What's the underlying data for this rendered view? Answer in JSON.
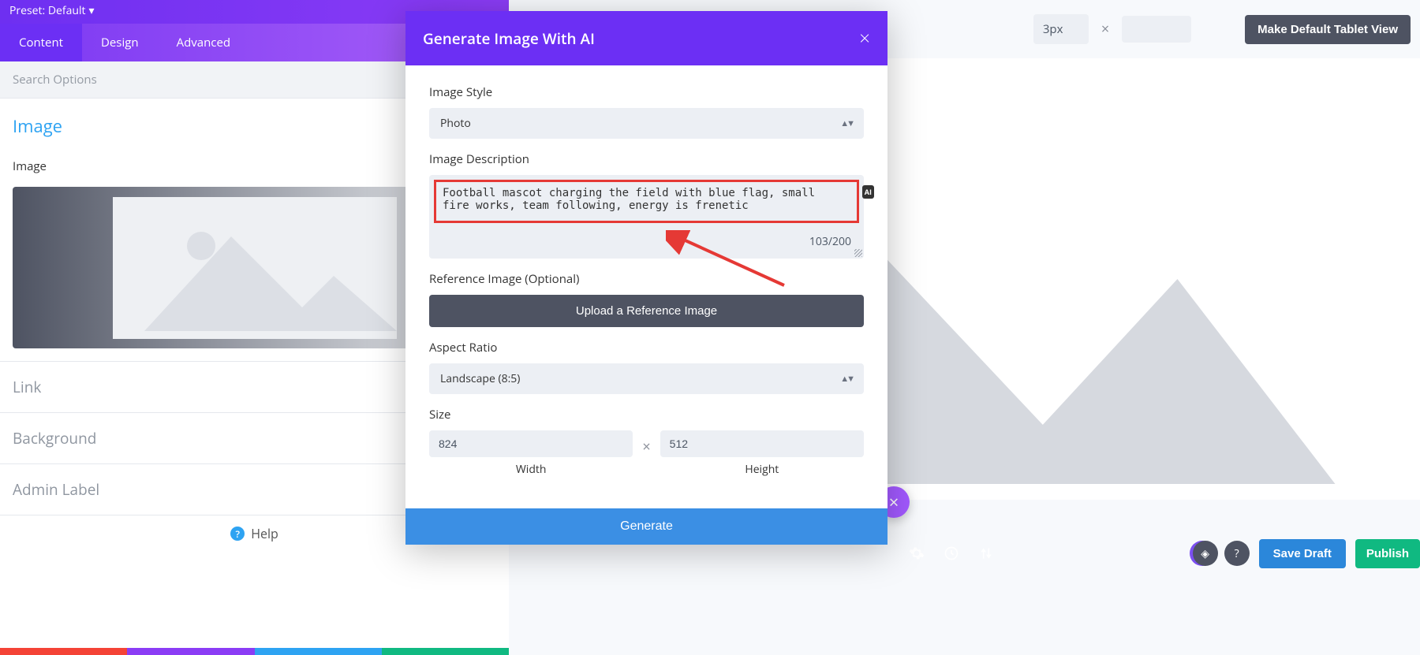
{
  "preset_label": "Preset: Default",
  "tabs": {
    "content": "Content",
    "design": "Design",
    "advanced": "Advanced"
  },
  "search_placeholder": "Search Options",
  "section": {
    "image_heading": "Image",
    "image_label": "Image",
    "link": "Link",
    "background": "Background",
    "admin_label": "Admin Label"
  },
  "help_label": "Help",
  "canvas": {
    "px_value": "3px",
    "default_view_btn": "Make Default Tablet View"
  },
  "bottom": {
    "save_draft": "Save Draft",
    "publish": "Publish"
  },
  "ai_modal": {
    "title": "Generate Image With AI",
    "image_style_label": "Image Style",
    "image_style_value": "Photo",
    "image_description_label": "Image Description",
    "image_description_value": "Football mascot charging the field with blue flag, small fire works, team following, energy is frenetic",
    "ai_badge": "AI",
    "counter": "103/200",
    "reference_image_label": "Reference Image (Optional)",
    "upload_btn": "Upload a Reference Image",
    "aspect_ratio_label": "Aspect Ratio",
    "aspect_ratio_value": "Landscape (8:5)",
    "size_label": "Size",
    "width_value": "824",
    "height_value": "512",
    "width_label": "Width",
    "height_label": "Height",
    "generate_btn": "Generate"
  }
}
